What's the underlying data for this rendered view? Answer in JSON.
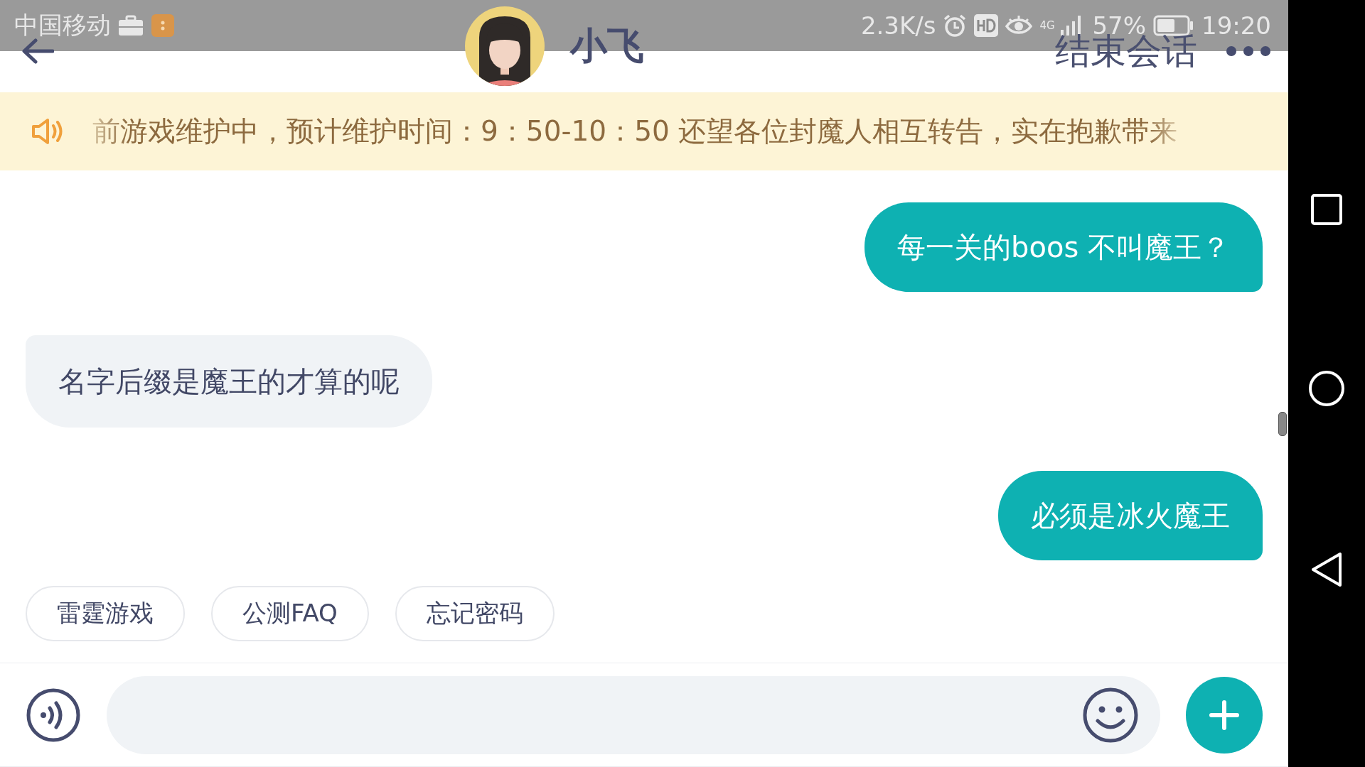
{
  "status_bar": {
    "carrier": "中国移动",
    "speed": "2.3K/s",
    "network": "4G",
    "battery": "57%",
    "time": "19:20"
  },
  "header": {
    "title": "小飞",
    "end_button": "结束会话"
  },
  "notice": {
    "text": "前游戏维护中，预计维护时间：9：50-10：50 还望各位封魔人相互转告，实在抱歉带来"
  },
  "messages": [
    {
      "kind": "user",
      "text": "每一关的boos 不叫魔王？"
    },
    {
      "kind": "agent",
      "text": "名字后缀是魔王的才算的呢"
    },
    {
      "kind": "user",
      "text": "必须是冰火魔王"
    }
  ],
  "quick_replies": [
    "雷霆游戏",
    "公测FAQ",
    "忘记密码"
  ]
}
